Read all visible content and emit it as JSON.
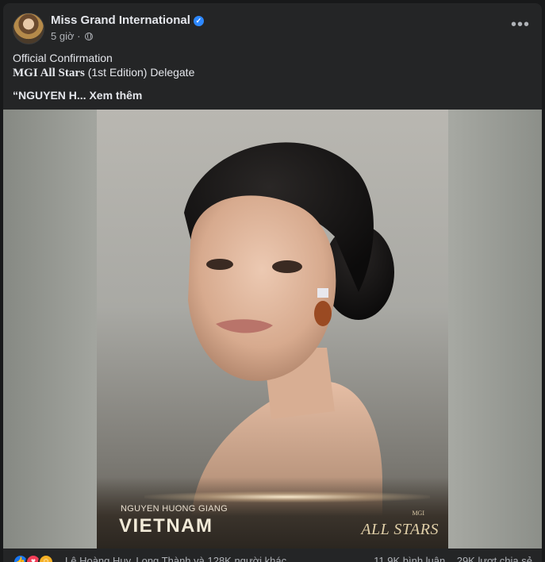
{
  "post": {
    "page_name": "Miss Grand International",
    "time": "5 giờ",
    "separator": "·",
    "text_line1": "Official Confirmation",
    "text_line2_bold": "MGI All Stars",
    "text_line2_rest": " (1st Edition) Delegate",
    "text_line3": "“NGUYEN H...",
    "see_more": "Xem thêm"
  },
  "photo": {
    "delegate_name": "NGUYEN HUONG GIANG",
    "country": "VIETNAM",
    "brand_small": "MGI",
    "brand": "ALL STARS"
  },
  "footer": {
    "reactors": "Lê Hoàng Huy, Long Thành và 128K người khác",
    "comments": "11,9K bình luận",
    "shares": "29K lượt chia sẻ"
  },
  "colors": {
    "background": "#18191a",
    "card": "#242526",
    "text_primary": "#e4e6eb",
    "text_secondary": "#b0b3b8",
    "verified": "#2d88ff"
  },
  "icons": {
    "verified": "verified-badge-icon",
    "privacy": "globe-icon",
    "more": "more-options-icon",
    "reactions": [
      "like-icon",
      "love-icon",
      "care-icon"
    ]
  }
}
